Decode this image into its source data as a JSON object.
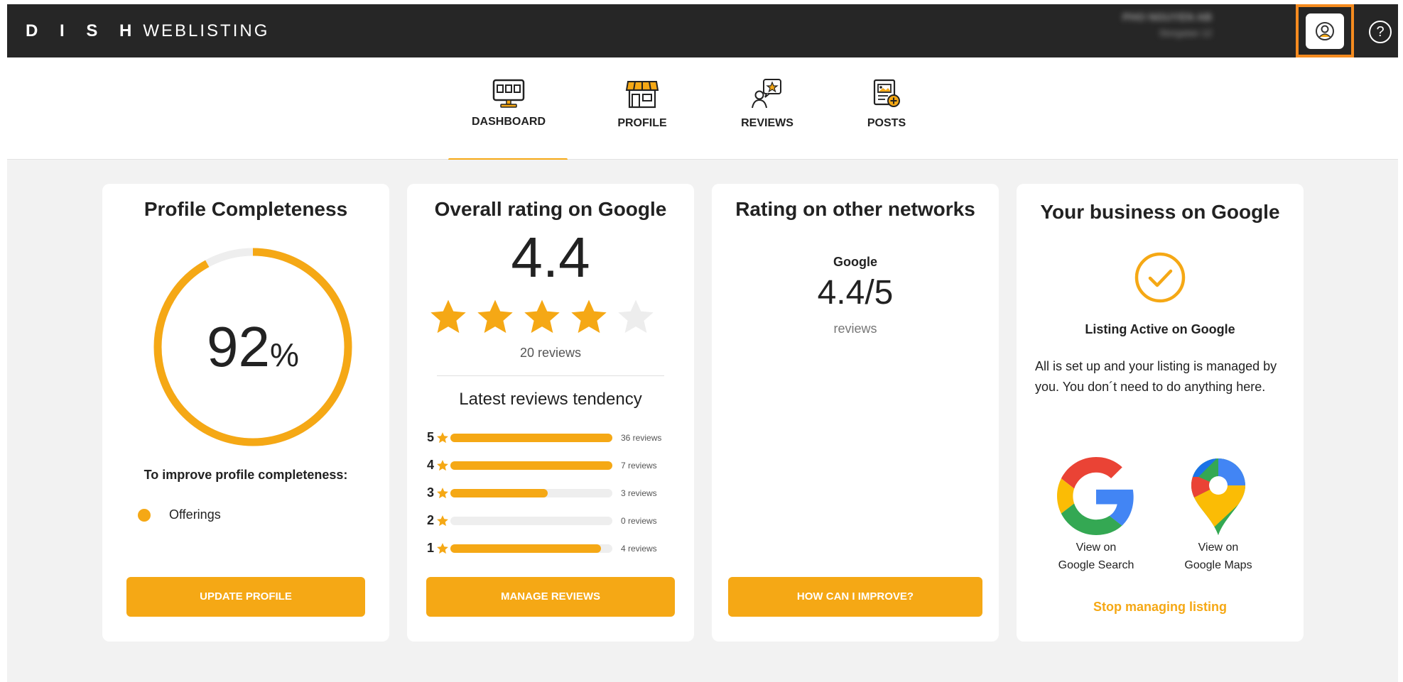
{
  "header": {
    "brand_bold": "D I S H",
    "brand_light": "WEBLISTING",
    "account_name": "PHO NGUYEN AB",
    "account_sub": "Storgatan 12",
    "help_glyph": "?"
  },
  "nav": {
    "tabs": [
      {
        "label": "DASHBOARD",
        "icon": "monitor-icon",
        "active": true
      },
      {
        "label": "PROFILE",
        "icon": "storefront-icon",
        "active": false
      },
      {
        "label": "REVIEWS",
        "icon": "review-person-icon",
        "active": false
      },
      {
        "label": "POSTS",
        "icon": "post-add-icon",
        "active": false
      }
    ]
  },
  "profile_card": {
    "title": "Profile Completeness",
    "percent_value": "92",
    "percent_symbol": "%",
    "completeness": 0.92,
    "improve_text": "To improve profile completeness:",
    "items": [
      "Offerings"
    ],
    "button_label": "UPDATE PROFILE"
  },
  "rating_card": {
    "title": "Overall rating on Google",
    "rating": "4.4",
    "stars_filled": 4,
    "stars_total": 5,
    "review_count": "20 reviews",
    "tendency_title": "Latest reviews tendency",
    "rows": [
      {
        "stars": "5",
        "count": "36 reviews",
        "fill": 1.0
      },
      {
        "stars": "4",
        "count": "7 reviews",
        "fill": 1.0
      },
      {
        "stars": "3",
        "count": "3 reviews",
        "fill": 0.6
      },
      {
        "stars": "2",
        "count": "0 reviews",
        "fill": 0.0
      },
      {
        "stars": "1",
        "count": "4 reviews",
        "fill": 0.93
      }
    ],
    "button_label": "MANAGE REVIEWS"
  },
  "networks_card": {
    "title": "Rating on other networks",
    "network": "Google",
    "value": "4.4/5",
    "reviews_label": "reviews",
    "button_label": "HOW CAN I IMPROVE?"
  },
  "business_card": {
    "title": "Your business on Google",
    "status": "Listing Active on Google",
    "description": "All is set up and your listing is managed by you. You don´t need to do anything here.",
    "search_line1": "View on",
    "search_line2": "Google Search",
    "maps_line1": "View on",
    "maps_line2": "Google Maps",
    "stop_label": "Stop managing listing"
  },
  "colors": {
    "accent": "#f5a815",
    "header_bg": "#262626",
    "highlight": "#f58b1f",
    "page_bg": "#f2f2f2"
  }
}
